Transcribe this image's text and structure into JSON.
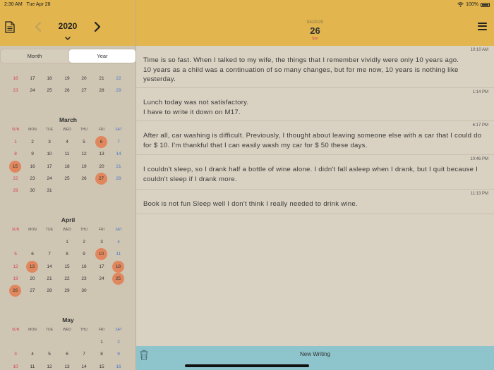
{
  "status_bar": {
    "time": "2:30 AM",
    "date": "Tue Apr 28",
    "battery": "100%"
  },
  "sidebar": {
    "year": "2020",
    "segments": {
      "month": "Month",
      "year": "Year"
    },
    "weekdays": [
      "SUN",
      "MON",
      "TUE",
      "WED",
      "THU",
      "FRI",
      "SAT"
    ],
    "partial_rows": [
      [
        "16",
        "17",
        "18",
        "19",
        "20",
        "21",
        "22"
      ],
      [
        "23",
        "24",
        "25",
        "26",
        "27",
        "28",
        "29"
      ]
    ],
    "months": [
      {
        "name": "March",
        "rows": [
          [
            "1",
            "2",
            "3",
            "4",
            "5",
            "6",
            "7"
          ],
          [
            "8",
            "9",
            "10",
            "11",
            "12",
            "13",
            "14"
          ],
          [
            "15",
            "16",
            "17",
            "18",
            "19",
            "20",
            "21"
          ],
          [
            "22",
            "23",
            "24",
            "25",
            "26",
            "27",
            "28"
          ],
          [
            "29",
            "30",
            "31",
            "",
            "",
            "",
            ""
          ]
        ],
        "marked": [
          "6",
          "15",
          "27"
        ]
      },
      {
        "name": "April",
        "rows": [
          [
            "",
            "",
            "",
            "1",
            "2",
            "3",
            "4"
          ],
          [
            "5",
            "6",
            "7",
            "8",
            "9",
            "10",
            "11"
          ],
          [
            "12",
            "13",
            "14",
            "15",
            "16",
            "17",
            "18"
          ],
          [
            "19",
            "20",
            "21",
            "22",
            "23",
            "24",
            "25"
          ],
          [
            "26",
            "27",
            "28",
            "29",
            "30",
            "",
            ""
          ]
        ],
        "marked": [
          "10",
          "13",
          "18",
          "25",
          "26"
        ]
      },
      {
        "name": "May",
        "rows": [
          [
            "",
            "",
            "",
            "",
            "",
            "1",
            "2"
          ],
          [
            "3",
            "4",
            "5",
            "6",
            "7",
            "8",
            "9"
          ],
          [
            "10",
            "11",
            "12",
            "13",
            "14",
            "15",
            "16"
          ]
        ],
        "marked": []
      }
    ]
  },
  "main": {
    "header": {
      "month_year": "04/2020",
      "day": "26",
      "weekday": "Sun"
    },
    "entries": [
      {
        "time": "10:10 AM",
        "text": "Time is so fast. When I talked to my wife, the things that I remember vividly were only 10 years ago.\n10 years as a child was a continuation of so many changes, but for me now, 10 years is nothing like yesterday."
      },
      {
        "time": "1:14 PM",
        "text": "Lunch today was not satisfactory.\nI have to write it down on M17."
      },
      {
        "time": "6:17 PM",
        "text": "After all, car washing is difficult. Previously, I thought about leaving someone else with a car that I could do for $ 10. I'm thankful that I can easily wash my car for $ 50 these days."
      },
      {
        "time": "10:46 PM",
        "text": "I couldn't sleep, so I drank half a bottle of wine alone. I didn't fall asleep when I drank, but I quit because I couldn't sleep if I drank more."
      },
      {
        "time": "11:13 PM",
        "text": "Book is not fun Sleep well I don't think I really needed to drink wine."
      }
    ],
    "bottom_bar": {
      "new_writing": "New Writing"
    }
  },
  "colors": {
    "header": "#e2b54e",
    "marked_day": "#e0875e",
    "sunday": "#d5424f",
    "saturday": "#4a78c8",
    "bottom_bar": "#8ec4cc"
  },
  "icons": [
    "document-icon",
    "chevron-left-icon",
    "chevron-right-icon",
    "chevron-down-icon",
    "hamburger-menu-icon",
    "trash-icon",
    "wifi-icon",
    "battery-icon"
  ]
}
